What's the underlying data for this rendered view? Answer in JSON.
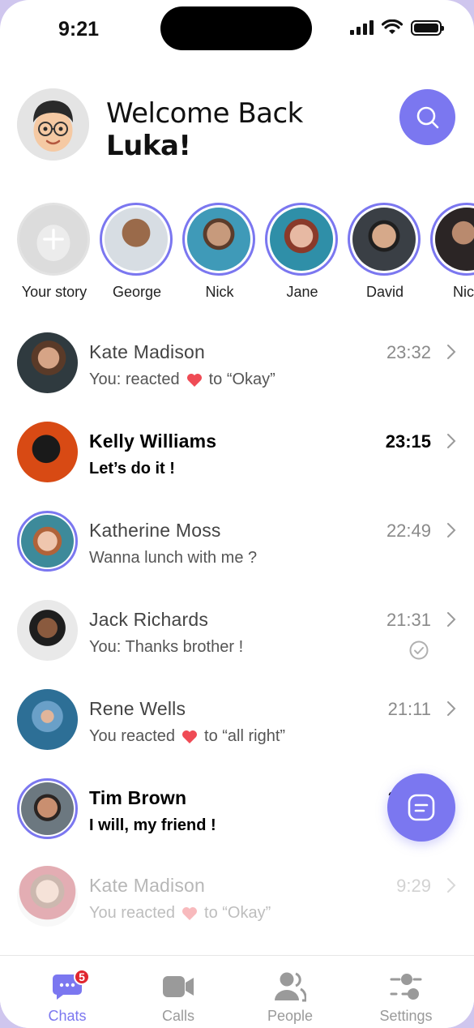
{
  "status_bar": {
    "time": "9:21"
  },
  "header": {
    "greeting": "Welcome Back",
    "user_name": "Luka!"
  },
  "colors": {
    "accent": "#7b77f0",
    "badge": "#e0262f",
    "heart": "#ef4b55"
  },
  "stories": [
    {
      "label": "Your story",
      "icon": "plus-icon"
    },
    {
      "label": "George"
    },
    {
      "label": "Nick"
    },
    {
      "label": "Jane"
    },
    {
      "label": "David"
    },
    {
      "label": "Nico"
    }
  ],
  "chats": [
    {
      "name": "Kate Madison",
      "message_before": "You: reacted",
      "message_after": " to “Okay”",
      "time": "23:32"
    },
    {
      "name": "Kelly Williams",
      "message": "Let’s do it !",
      "time": "23:15"
    },
    {
      "name": "Katherine Moss",
      "message": "Wanna lunch with me ?",
      "time": "22:49"
    },
    {
      "name": "Jack Richards",
      "message": "You: Thanks brother !",
      "time": "21:31",
      "status_icon": "read-check-icon"
    },
    {
      "name": "Rene Wells",
      "message_before": "You reacted",
      "message_after": "to “all right”",
      "time": "21:11"
    },
    {
      "name": "Tim Brown",
      "message": "I will, my friend !",
      "time": "2"
    },
    {
      "name": "Kate Madison",
      "message_before": "You reacted",
      "message_after": "to “Okay”",
      "time": "9:29"
    }
  ],
  "tabs": [
    {
      "label": "Chats",
      "badge": "5",
      "icon": "chat-icon"
    },
    {
      "label": "Calls",
      "icon": "video-icon"
    },
    {
      "label": "People",
      "icon": "people-icon"
    },
    {
      "label": "Settings",
      "icon": "sliders-icon"
    }
  ]
}
